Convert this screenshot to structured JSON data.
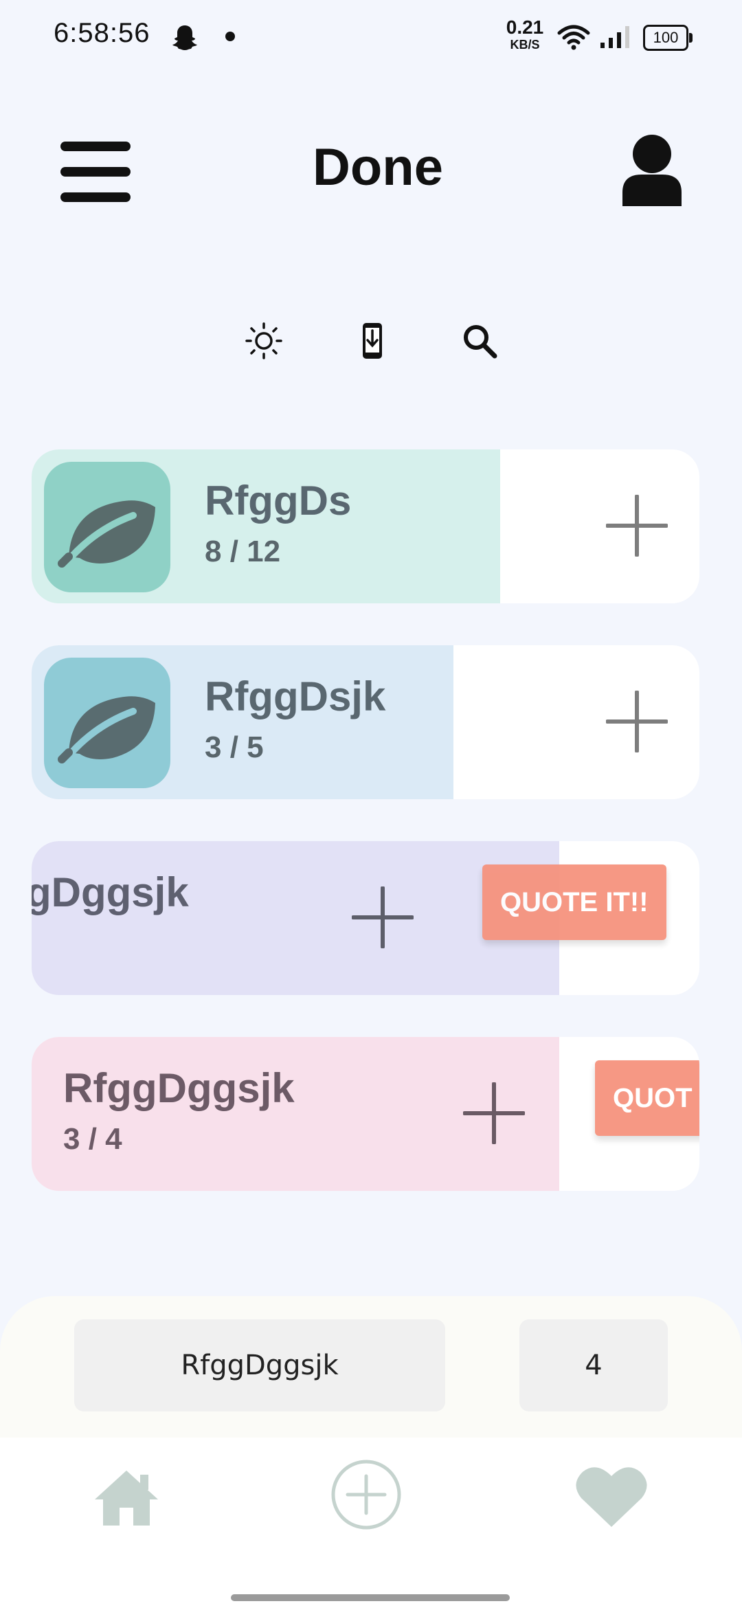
{
  "status_bar": {
    "time": "6:58:56",
    "net_speed_value": "0.21",
    "net_speed_unit": "KB/S",
    "battery": "100"
  },
  "header": {
    "title": "Done",
    "menu_icon": "hamburger-menu-icon",
    "profile_icon": "user-profile-icon"
  },
  "toolbar": {
    "icons": [
      "brightness-icon",
      "phone-download-icon",
      "search-icon"
    ]
  },
  "cards": [
    {
      "name": "RfggDs",
      "count": "8 / 12",
      "progress": 0.667,
      "fill_color": "#d6f0ec",
      "thumb_color": "#8fd1c6",
      "icon": "leaf-icon"
    },
    {
      "name": "RfggDsjk",
      "count": "3 / 5",
      "progress": 0.6,
      "fill_color": "#dbeaf6",
      "thumb_color": "#8fcbd6",
      "icon": "leaf-icon"
    },
    {
      "name": "gDggsjk",
      "count": "",
      "progress": 0.8,
      "fill_color": "#e2e1f6",
      "quote_label": "QUOTE IT!!"
    },
    {
      "name": "RfggDggsjk",
      "count": "3 / 4",
      "progress": 0.8,
      "fill_color": "#f8e0eb",
      "quote_label": "QUOT"
    }
  ],
  "bottom_panel": {
    "name_value": "RfggDggsjk",
    "count_value": "4"
  },
  "bottom_nav": {
    "items": [
      "home-icon",
      "add-circle-icon",
      "heart-icon"
    ],
    "color": "#c5d3ce"
  }
}
